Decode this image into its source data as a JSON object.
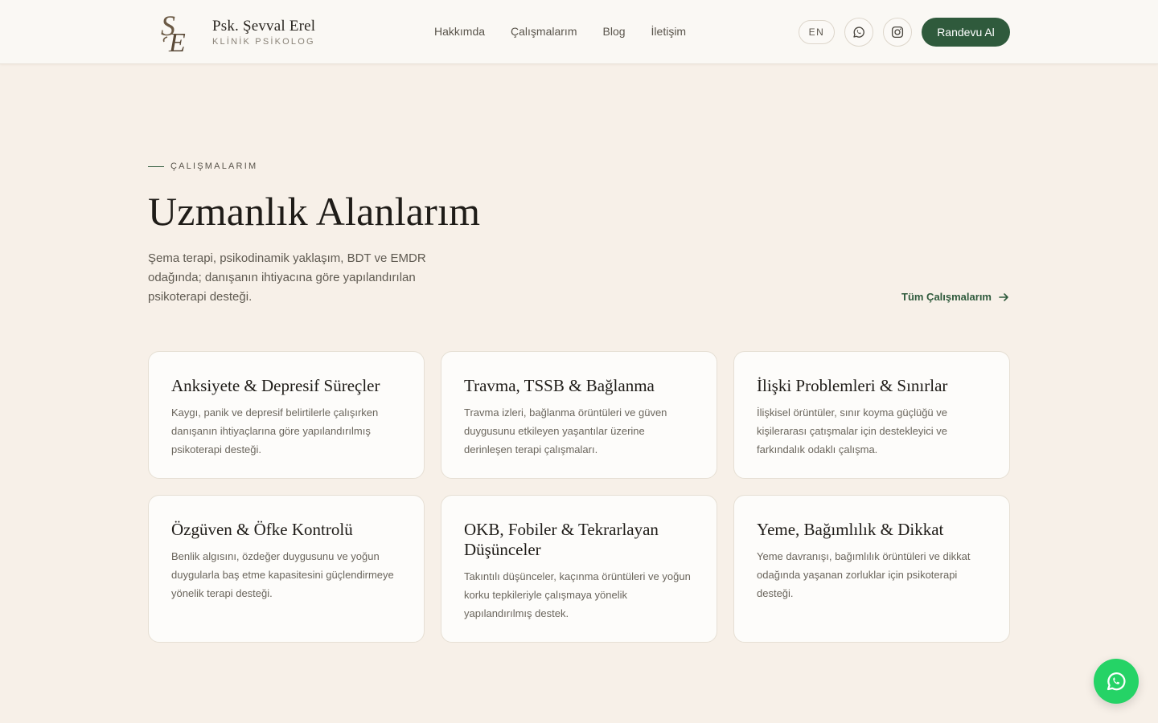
{
  "header": {
    "brand_name": "Psk. Şevval Erel",
    "brand_subtitle": "KLİNİK PSİKOLOG",
    "logo_letters": "ŞE",
    "nav": [
      "Hakkımda",
      "Çalışmalarım",
      "Blog",
      "İletişim"
    ],
    "lang_label": "EN",
    "cta_label": "Randevu Al",
    "icons": {
      "whatsapp": "whatsapp-icon",
      "instagram": "instagram-icon"
    }
  },
  "section": {
    "eyebrow": "ÇALIŞMALARIM",
    "title": "Uzmanlık Alanlarım",
    "description": "Şema terapi, psikodinamik yaklaşım, BDT ve EMDR odağında; danışanın ihtiyacına göre yapılandırılan psikoterapi desteği.",
    "all_link": "Tüm Çalışmalarım"
  },
  "cards": [
    {
      "title": "Anksiyete & Depresif Süreçler",
      "text": "Kaygı, panik ve depresif belirtilerle çalışırken danışanın ihtiyaçlarına göre yapılandırılmış psikoterapi desteği."
    },
    {
      "title": "Travma, TSSB & Bağlanma",
      "text": "Travma izleri, bağlanma örüntüleri ve güven duygusunu etkileyen yaşantılar üzerine derinleşen terapi çalışmaları."
    },
    {
      "title": "İlişki Problemleri & Sınırlar",
      "text": "İlişkisel örüntüler, sınır koyma güçlüğü ve kişilerarası çatışmalar için destekleyici ve farkındalık odaklı çalışma."
    },
    {
      "title": "Özgüven & Öfke Kontrolü",
      "text": "Benlik algısını, özdeğer duygusunu ve yoğun duygularla baş etme kapasitesini güçlendirmeye yönelik terapi desteği."
    },
    {
      "title": "OKB, Fobiler & Tekrarlayan Düşünceler",
      "text": "Takıntılı düşünceler, kaçınma örüntüleri ve yoğun korku tepkileriyle çalışmaya yönelik yapılandırılmış destek."
    },
    {
      "title": "Yeme, Bağımlılık & Dikkat",
      "text": "Yeme davranışı, bağımlılık örüntüleri ve dikkat odağında yaşanan zorluklar için psikoterapi desteği."
    }
  ],
  "colors": {
    "background": "#f7f0e8",
    "accent": "#2f5a3c",
    "whatsapp": "#25d366",
    "logo": "#6b5a45"
  }
}
